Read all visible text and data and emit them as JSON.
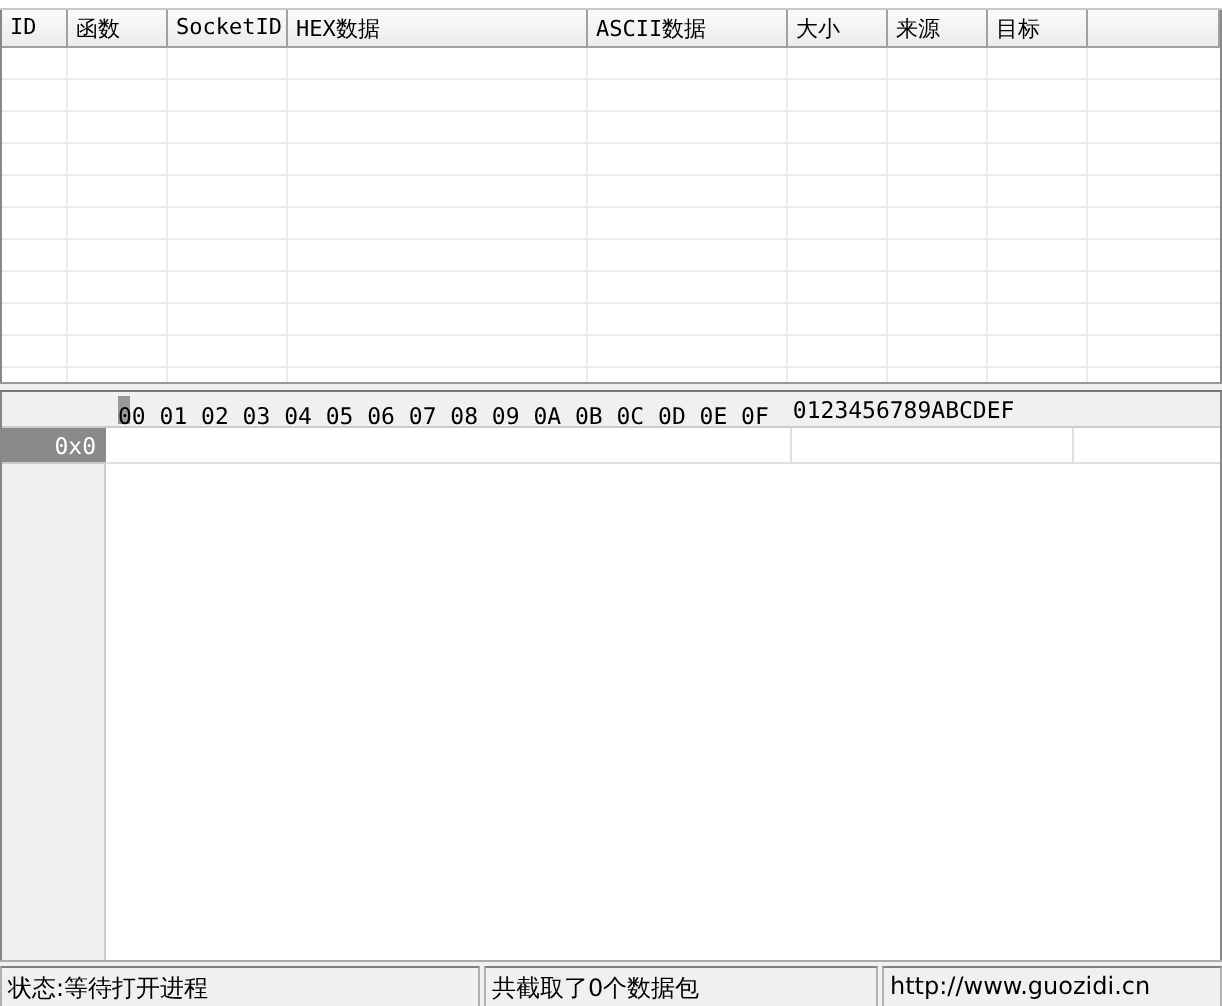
{
  "packet_table": {
    "columns": [
      {
        "label": "ID"
      },
      {
        "label": "函数"
      },
      {
        "label": "SocketID"
      },
      {
        "label": "HEX数据"
      },
      {
        "label": "ASCII数据"
      },
      {
        "label": "大小"
      },
      {
        "label": "来源"
      },
      {
        "label": "目标"
      }
    ]
  },
  "hex_view": {
    "hex_header": "00 01 02 03 04 05 06 07 08 09 0A 0B 0C 0D 0E 0F",
    "ascii_header": "0123456789ABCDEF",
    "rows": [
      {
        "offset": "0x0"
      }
    ]
  },
  "status_bar": {
    "state": "状态:等待打开进程",
    "count": "共截取了0个数据包",
    "url": "http://www.guozidi.cn"
  }
}
